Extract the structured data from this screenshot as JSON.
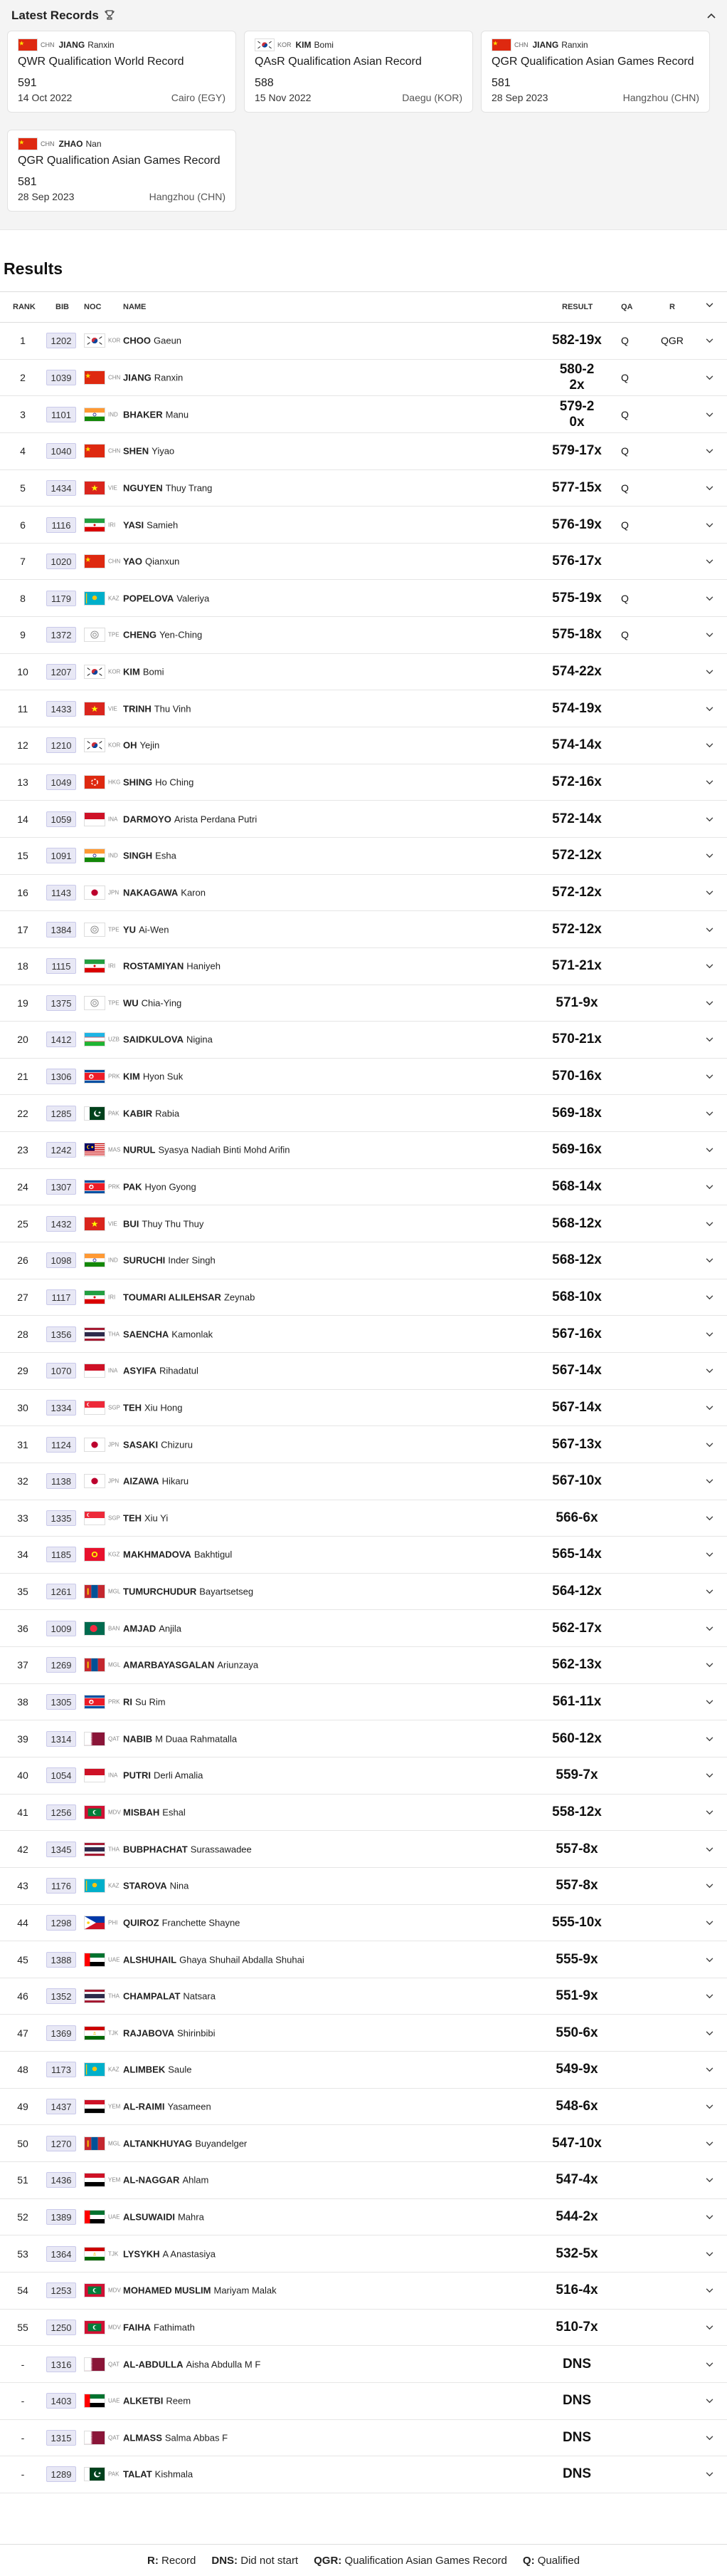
{
  "records": {
    "title": "Latest Records",
    "cards": [
      {
        "noc": "CHN",
        "surname": "JIANG",
        "given": "Ranxin",
        "desc": "QWR  Qualification World Record",
        "score": "591",
        "date": "14 Oct 2022",
        "location": "Cairo (EGY)"
      },
      {
        "noc": "KOR",
        "surname": "KIM",
        "given": "Bomi",
        "desc": "QAsR  Qualification Asian Record",
        "score": "588",
        "date": "15 Nov 2022",
        "location": "Daegu (KOR)"
      },
      {
        "noc": "CHN",
        "surname": "JIANG",
        "given": "Ranxin",
        "desc": "QGR  Qualification Asian Games Record",
        "score": "581",
        "date": "28 Sep 2023",
        "location": "Hangzhou (CHN)"
      },
      {
        "noc": "CHN",
        "surname": "ZHAO",
        "given": "Nan",
        "desc": "QGR  Qualification Asian Games Record",
        "score": "581",
        "date": "28 Sep 2023",
        "location": "Hangzhou (CHN)"
      }
    ]
  },
  "results": {
    "title": "Results",
    "headers": {
      "rank": "RANK",
      "bib": "BIB",
      "noc": "NOC",
      "name": "NAME",
      "result": "RESULT",
      "qa": "QA",
      "r": "R"
    },
    "rows": [
      {
        "rank": "1",
        "bib": "1202",
        "noc": "KOR",
        "surname": "CHOO",
        "given": "Gaeun",
        "result": "582-19x",
        "qa": "Q",
        "r": "QGR"
      },
      {
        "rank": "2",
        "bib": "1039",
        "noc": "CHN",
        "surname": "JIANG",
        "given": "Ranxin",
        "result": "580-22x",
        "qa": "Q",
        "r": ""
      },
      {
        "rank": "3",
        "bib": "1101",
        "noc": "IND",
        "surname": "BHAKER",
        "given": "Manu",
        "result": "579-20x",
        "qa": "Q",
        "r": ""
      },
      {
        "rank": "4",
        "bib": "1040",
        "noc": "CHN",
        "surname": "SHEN",
        "given": "Yiyao",
        "result": "579-17x",
        "qa": "Q",
        "r": ""
      },
      {
        "rank": "5",
        "bib": "1434",
        "noc": "VIE",
        "surname": "NGUYEN",
        "given": "Thuy Trang",
        "result": "577-15x",
        "qa": "Q",
        "r": ""
      },
      {
        "rank": "6",
        "bib": "1116",
        "noc": "IRI",
        "surname": "YASI",
        "given": "Samieh",
        "result": "576-19x",
        "qa": "Q",
        "r": ""
      },
      {
        "rank": "7",
        "bib": "1020",
        "noc": "CHN",
        "surname": "YAO",
        "given": "Qianxun",
        "result": "576-17x",
        "qa": "",
        "r": ""
      },
      {
        "rank": "8",
        "bib": "1179",
        "noc": "KAZ",
        "surname": "POPELOVA",
        "given": "Valeriya",
        "result": "575-19x",
        "qa": "Q",
        "r": ""
      },
      {
        "rank": "9",
        "bib": "1372",
        "noc": "TPE",
        "surname": "CHENG",
        "given": "Yen-Ching",
        "result": "575-18x",
        "qa": "Q",
        "r": ""
      },
      {
        "rank": "10",
        "bib": "1207",
        "noc": "KOR",
        "surname": "KIM",
        "given": "Bomi",
        "result": "574-22x",
        "qa": "",
        "r": ""
      },
      {
        "rank": "11",
        "bib": "1433",
        "noc": "VIE",
        "surname": "TRINH",
        "given": "Thu Vinh",
        "result": "574-19x",
        "qa": "",
        "r": ""
      },
      {
        "rank": "12",
        "bib": "1210",
        "noc": "KOR",
        "surname": "OH",
        "given": "Yejin",
        "result": "574-14x",
        "qa": "",
        "r": ""
      },
      {
        "rank": "13",
        "bib": "1049",
        "noc": "HKG",
        "surname": "SHING",
        "given": "Ho Ching",
        "result": "572-16x",
        "qa": "",
        "r": ""
      },
      {
        "rank": "14",
        "bib": "1059",
        "noc": "INA",
        "surname": "DARMOYO",
        "given": "Arista Perdana Putri",
        "result": "572-14x",
        "qa": "",
        "r": ""
      },
      {
        "rank": "15",
        "bib": "1091",
        "noc": "IND",
        "surname": "SINGH",
        "given": "Esha",
        "result": "572-12x",
        "qa": "",
        "r": ""
      },
      {
        "rank": "16",
        "bib": "1143",
        "noc": "JPN",
        "surname": "NAKAGAWA",
        "given": "Karon",
        "result": "572-12x",
        "qa": "",
        "r": ""
      },
      {
        "rank": "17",
        "bib": "1384",
        "noc": "TPE",
        "surname": "YU",
        "given": "Ai-Wen",
        "result": "572-12x",
        "qa": "",
        "r": ""
      },
      {
        "rank": "18",
        "bib": "1115",
        "noc": "IRI",
        "surname": "ROSTAMIYAN",
        "given": "Haniyeh",
        "result": "571-21x",
        "qa": "",
        "r": ""
      },
      {
        "rank": "19",
        "bib": "1375",
        "noc": "TPE",
        "surname": "WU",
        "given": "Chia-Ying",
        "result": "571-9x",
        "qa": "",
        "r": ""
      },
      {
        "rank": "20",
        "bib": "1412",
        "noc": "UZB",
        "surname": "SAIDKULOVA",
        "given": "Nigina",
        "result": "570-21x",
        "qa": "",
        "r": ""
      },
      {
        "rank": "21",
        "bib": "1306",
        "noc": "PRK",
        "surname": "KIM",
        "given": "Hyon Suk",
        "result": "570-16x",
        "qa": "",
        "r": ""
      },
      {
        "rank": "22",
        "bib": "1285",
        "noc": "PAK",
        "surname": "KABIR",
        "given": "Rabia",
        "result": "569-18x",
        "qa": "",
        "r": ""
      },
      {
        "rank": "23",
        "bib": "1242",
        "noc": "MAS",
        "surname": "NURUL",
        "given": "Syasya Nadiah Binti Mohd Arifin",
        "result": "569-16x",
        "qa": "",
        "r": ""
      },
      {
        "rank": "24",
        "bib": "1307",
        "noc": "PRK",
        "surname": "PAK",
        "given": "Hyon Gyong",
        "result": "568-14x",
        "qa": "",
        "r": ""
      },
      {
        "rank": "25",
        "bib": "1432",
        "noc": "VIE",
        "surname": "BUI",
        "given": "Thuy Thu Thuy",
        "result": "568-12x",
        "qa": "",
        "r": ""
      },
      {
        "rank": "26",
        "bib": "1098",
        "noc": "IND",
        "surname": "SURUCHI",
        "given": "Inder Singh",
        "result": "568-12x",
        "qa": "",
        "r": ""
      },
      {
        "rank": "27",
        "bib": "1117",
        "noc": "IRI",
        "surname": "TOUMARI ALILEHSAR",
        "given": "Zeynab",
        "result": "568-10x",
        "qa": "",
        "r": ""
      },
      {
        "rank": "28",
        "bib": "1356",
        "noc": "THA",
        "surname": "SAENCHA",
        "given": "Kamonlak",
        "result": "567-16x",
        "qa": "",
        "r": ""
      },
      {
        "rank": "29",
        "bib": "1070",
        "noc": "INA",
        "surname": "ASYIFA",
        "given": "Rihadatul",
        "result": "567-14x",
        "qa": "",
        "r": ""
      },
      {
        "rank": "30",
        "bib": "1334",
        "noc": "SGP",
        "surname": "TEH",
        "given": "Xiu Hong",
        "result": "567-14x",
        "qa": "",
        "r": ""
      },
      {
        "rank": "31",
        "bib": "1124",
        "noc": "JPN",
        "surname": "SASAKI",
        "given": "Chizuru",
        "result": "567-13x",
        "qa": "",
        "r": ""
      },
      {
        "rank": "32",
        "bib": "1138",
        "noc": "JPN",
        "surname": "AIZAWA",
        "given": "Hikaru",
        "result": "567-10x",
        "qa": "",
        "r": ""
      },
      {
        "rank": "33",
        "bib": "1335",
        "noc": "SGP",
        "surname": "TEH",
        "given": "Xiu Yi",
        "result": "566-6x",
        "qa": "",
        "r": ""
      },
      {
        "rank": "34",
        "bib": "1185",
        "noc": "KGZ",
        "surname": "MAKHMADOVA",
        "given": "Bakhtigul",
        "result": "565-14x",
        "qa": "",
        "r": ""
      },
      {
        "rank": "35",
        "bib": "1261",
        "noc": "MGL",
        "surname": "TUMURCHUDUR",
        "given": "Bayartsetseg",
        "result": "564-12x",
        "qa": "",
        "r": ""
      },
      {
        "rank": "36",
        "bib": "1009",
        "noc": "BAN",
        "surname": "AMJAD",
        "given": "Anjila",
        "result": "562-17x",
        "qa": "",
        "r": ""
      },
      {
        "rank": "37",
        "bib": "1269",
        "noc": "MGL",
        "surname": "AMARBAYASGALAN",
        "given": "Ariunzaya",
        "result": "562-13x",
        "qa": "",
        "r": ""
      },
      {
        "rank": "38",
        "bib": "1305",
        "noc": "PRK",
        "surname": "RI",
        "given": "Su Rim",
        "result": "561-11x",
        "qa": "",
        "r": ""
      },
      {
        "rank": "39",
        "bib": "1314",
        "noc": "QAT",
        "surname": "NABIB",
        "given": "M Duaa Rahmatalla",
        "result": "560-12x",
        "qa": "",
        "r": ""
      },
      {
        "rank": "40",
        "bib": "1054",
        "noc": "INA",
        "surname": "PUTRI",
        "given": "Derli Amalia",
        "result": "559-7x",
        "qa": "",
        "r": ""
      },
      {
        "rank": "41",
        "bib": "1256",
        "noc": "MDV",
        "surname": "MISBAH",
        "given": "Eshal",
        "result": "558-12x",
        "qa": "",
        "r": ""
      },
      {
        "rank": "42",
        "bib": "1345",
        "noc": "THA",
        "surname": "BUBPHACHAT",
        "given": "Surassawadee",
        "result": "557-8x",
        "qa": "",
        "r": ""
      },
      {
        "rank": "43",
        "bib": "1176",
        "noc": "KAZ",
        "surname": "STAROVA",
        "given": "Nina",
        "result": "557-8x",
        "qa": "",
        "r": ""
      },
      {
        "rank": "44",
        "bib": "1298",
        "noc": "PHI",
        "surname": "QUIROZ",
        "given": "Franchette Shayne",
        "result": "555-10x",
        "qa": "",
        "r": ""
      },
      {
        "rank": "45",
        "bib": "1388",
        "noc": "UAE",
        "surname": "ALSHUHAIL",
        "given": "Ghaya Shuhail Abdalla Shuhai",
        "result": "555-9x",
        "qa": "",
        "r": ""
      },
      {
        "rank": "46",
        "bib": "1352",
        "noc": "THA",
        "surname": "CHAMPALAT",
        "given": "Natsara",
        "result": "551-9x",
        "qa": "",
        "r": ""
      },
      {
        "rank": "47",
        "bib": "1369",
        "noc": "TJK",
        "surname": "RAJABOVA",
        "given": "Shirinbibi",
        "result": "550-6x",
        "qa": "",
        "r": ""
      },
      {
        "rank": "48",
        "bib": "1173",
        "noc": "KAZ",
        "surname": "ALIMBEK",
        "given": "Saule",
        "result": "549-9x",
        "qa": "",
        "r": ""
      },
      {
        "rank": "49",
        "bib": "1437",
        "noc": "YEM",
        "surname": "AL-RAIMI",
        "given": "Yasameen",
        "result": "548-6x",
        "qa": "",
        "r": ""
      },
      {
        "rank": "50",
        "bib": "1270",
        "noc": "MGL",
        "surname": "ALTANKHUYAG",
        "given": "Buyandelger",
        "result": "547-10x",
        "qa": "",
        "r": ""
      },
      {
        "rank": "51",
        "bib": "1436",
        "noc": "YEM",
        "surname": "AL-NAGGAR",
        "given": "Ahlam",
        "result": "547-4x",
        "qa": "",
        "r": ""
      },
      {
        "rank": "52",
        "bib": "1389",
        "noc": "UAE",
        "surname": "ALSUWAIDI",
        "given": "Mahra",
        "result": "544-2x",
        "qa": "",
        "r": ""
      },
      {
        "rank": "53",
        "bib": "1364",
        "noc": "TJK",
        "surname": "LYSYKH",
        "given": "A Anastasiya",
        "result": "532-5x",
        "qa": "",
        "r": ""
      },
      {
        "rank": "54",
        "bib": "1253",
        "noc": "MDV",
        "surname": "MOHAMED MUSLIM",
        "given": "Mariyam Malak",
        "result": "516-4x",
        "qa": "",
        "r": ""
      },
      {
        "rank": "55",
        "bib": "1250",
        "noc": "MDV",
        "surname": "FAIHA",
        "given": "Fathimath",
        "result": "510-7x",
        "qa": "",
        "r": ""
      },
      {
        "rank": "-",
        "bib": "1316",
        "noc": "QAT",
        "surname": "AL-ABDULLA",
        "given": "Aisha Abdulla M F",
        "result": "DNS",
        "qa": "",
        "r": ""
      },
      {
        "rank": "-",
        "bib": "1403",
        "noc": "UAE",
        "surname": "ALKETBI",
        "given": "Reem",
        "result": "DNS",
        "qa": "",
        "r": ""
      },
      {
        "rank": "-",
        "bib": "1315",
        "noc": "QAT",
        "surname": "ALMASS",
        "given": "Salma Abbas F",
        "result": "DNS",
        "qa": "",
        "r": ""
      },
      {
        "rank": "-",
        "bib": "1289",
        "noc": "PAK",
        "surname": "TALAT",
        "given": "Kishmala",
        "result": "DNS",
        "qa": "",
        "r": ""
      }
    ]
  },
  "legend": [
    {
      "key": "R:",
      "value": "Record"
    },
    {
      "key": "DNS:",
      "value": "Did not start"
    },
    {
      "key": "QGR:",
      "value": "Qualification Asian Games Record"
    },
    {
      "key": "Q:",
      "value": "Qualified"
    }
  ],
  "icons": {
    "trophy": "trophy-icon",
    "collapse": "chevron-up-icon",
    "expand": "chevron-down-icon",
    "sort": "chevron-down-icon"
  }
}
